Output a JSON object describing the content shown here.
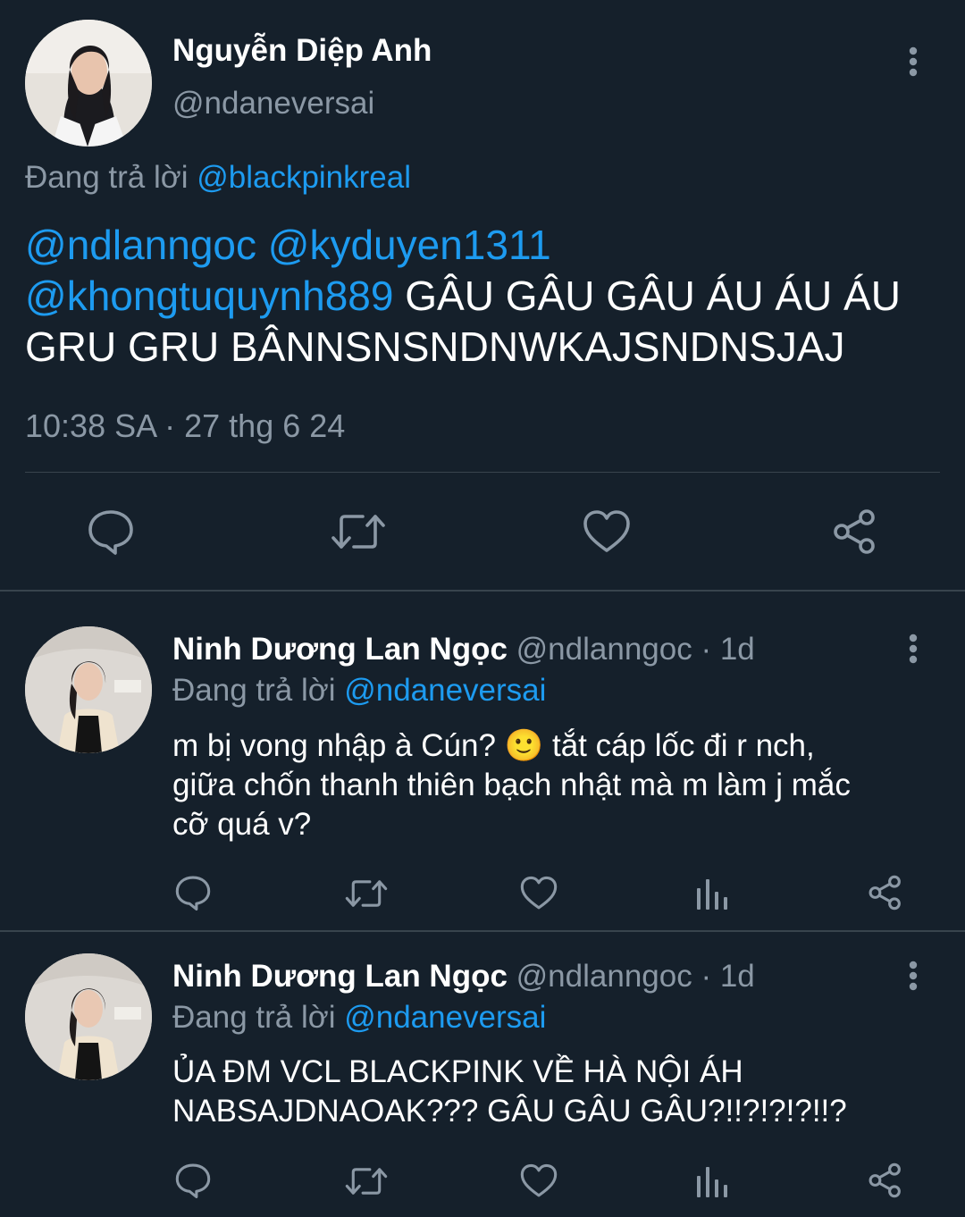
{
  "main_tweet": {
    "author_name": "Nguyễn Diệp Anh",
    "handle": "@ndaneversai",
    "replying_prefix": "Đang trả lời",
    "replying_to": "@blackpinkreal",
    "mention_1": "@ndlanngoc",
    "mention_2": "@kyduyen1311",
    "mention_3": "@khongtuquynh889",
    "text_line_2_tail": "GÂU GÂU GÂU ÁU ÁU ÁU",
    "text_line_3": "GRU GRU BÂNNSNSNDNWKAJSNDNSJAJ",
    "timestamp": "10:38 SA · 27 thg 6 24"
  },
  "replies": [
    {
      "author_name": "Ninh Dương Lan Ngọc",
      "meta": "@ndlanngoc · 1d",
      "replying_prefix": "Đang trả lời",
      "replying_to": "@ndaneversai",
      "text_line_1a": "m bị vong nhập à Cún?",
      "emoji": "🙂",
      "text_line_1b": "tắt cáp lốc đi r nch,",
      "text_line_2": "giữa chốn thanh thiên bạch nhật mà m làm j mắc",
      "text_line_3": "cỡ quá v?"
    },
    {
      "author_name": "Ninh Dương Lan Ngọc",
      "meta": "@ndlanngoc · 1d",
      "replying_prefix": "Đang trả lời",
      "replying_to": "@ndaneversai",
      "text_line_1": "ỦA ĐM VCL BLACKPINK VỀ HÀ NỘI ÁH",
      "text_line_2": "NABSAJDNAOAK??? GÂU GÂU GÂU?!!?!?!?!!?"
    }
  ],
  "icons": {
    "reply": "speech-bubble-icon",
    "retweet": "retweet-icon",
    "like": "heart-icon",
    "analytics": "bar-chart-icon",
    "share": "share-icon",
    "more": "vertical-dots-icon"
  },
  "colors": {
    "background": "#15202b",
    "link": "#1d9bf0",
    "muted": "#8b98a5",
    "divider": "#38444d"
  }
}
